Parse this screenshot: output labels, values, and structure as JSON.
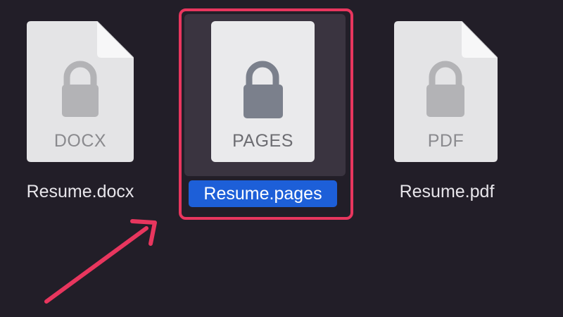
{
  "colors": {
    "background": "#221e28",
    "selection_background": "#3a3440",
    "selection_label": "#1d5fd8",
    "annotation": "#e8365e"
  },
  "files": [
    {
      "name": "Resume.docx",
      "ext": "DOCX",
      "icon": "locked-document-icon",
      "selected": false
    },
    {
      "name": "Resume.pages",
      "ext": "PAGES",
      "icon": "locked-document-icon",
      "selected": true
    },
    {
      "name": "Resume.pdf",
      "ext": "PDF",
      "icon": "locked-document-icon",
      "selected": false
    }
  ],
  "annotation": {
    "highlight": "selected-file",
    "arrow_icon": "arrow-icon"
  }
}
